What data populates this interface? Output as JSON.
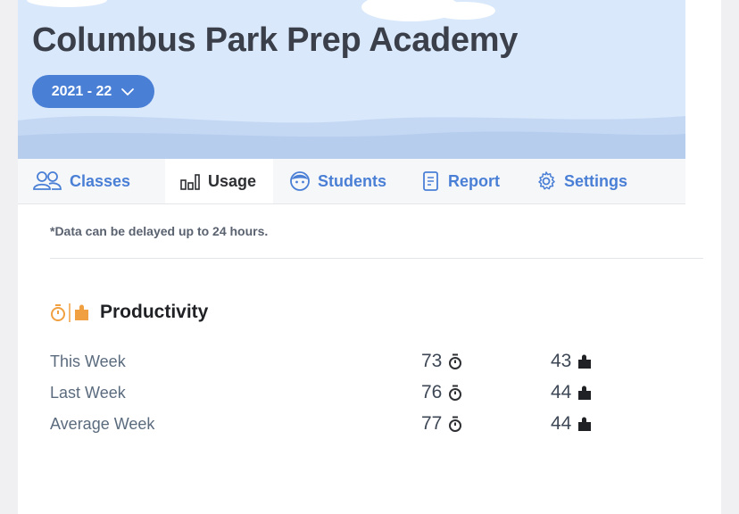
{
  "header": {
    "school_name": "Columbus Park Prep Academy",
    "year_selector": "2021 - 22"
  },
  "tabs": [
    {
      "label": "Classes",
      "icon": "people-icon",
      "active": false
    },
    {
      "label": "Usage",
      "icon": "bar-chart-icon",
      "active": true
    },
    {
      "label": "Students",
      "icon": "student-face-icon",
      "active": false
    },
    {
      "label": "Report",
      "icon": "report-icon",
      "active": false
    },
    {
      "label": "Settings",
      "icon": "gear-icon",
      "active": false
    }
  ],
  "notice": "*Data can be delayed up to 24 hours.",
  "productivity": {
    "title": "Productivity",
    "rows": [
      {
        "label": "This Week",
        "minutes": "73",
        "puzzles": "43"
      },
      {
        "label": "Last Week",
        "minutes": "76",
        "puzzles": "44"
      },
      {
        "label": "Average Week",
        "minutes": "77",
        "puzzles": "44"
      }
    ]
  },
  "colors": {
    "accent": "#4a7fd6",
    "hero_background": "#d9e8fb",
    "orange_icon": "#f0a040"
  }
}
